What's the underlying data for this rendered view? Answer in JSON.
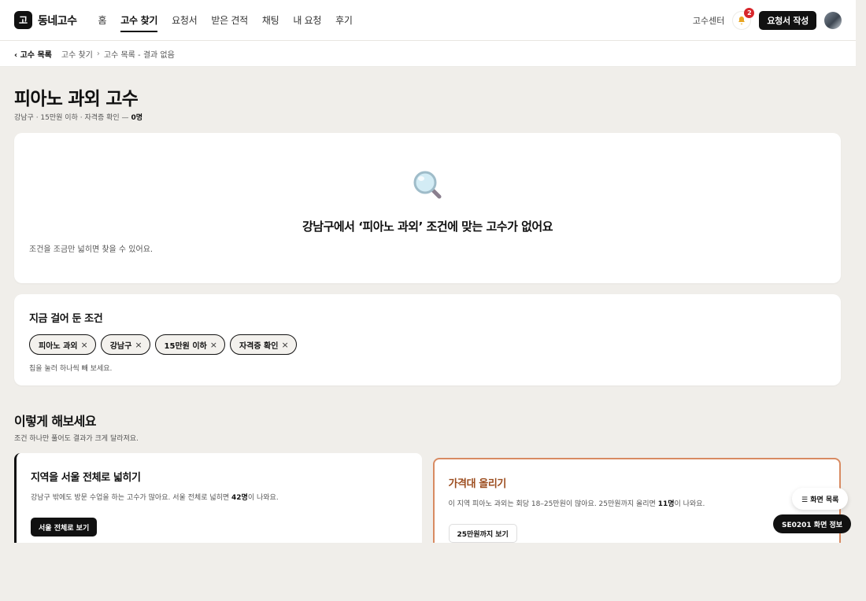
{
  "header": {
    "logo_mark": "고",
    "logo_text": "동네고수",
    "nav": [
      "홈",
      "고수 찾기",
      "요청서",
      "받은 견적",
      "채팅",
      "내 요청",
      "후기"
    ],
    "help_link": "고수센터",
    "notification_count": "2",
    "write_button": "요청서 작성"
  },
  "breadcrumb": {
    "back": "‹ 고수 목록",
    "items": [
      "고수 찾기",
      "고수 목록 - 결과 없음"
    ]
  },
  "page": {
    "title": "피아노 과외 고수",
    "subtitle_prefix": "강남구 · 15만원 이하 · 자격증 확인 —",
    "count": "0명"
  },
  "empty_state": {
    "title": "강남구에서 ‘피아노 과외’ 조건에 맞는 고수가 없어요",
    "description": "조건을 조금만 넓히면 찾을 수 있어요."
  },
  "filters": {
    "heading": "지금 걸어 둔 조건",
    "chips": [
      "피아노 과외",
      "강남구",
      "15만원 이하",
      "자격증 확인"
    ],
    "hint": "칩을 눌러 하나씩 빼 보세요."
  },
  "suggestions": {
    "title": "이렇게 해보세요",
    "subtitle": "조건 하나만 풀어도 결과가 크게 달라져요.",
    "cards": [
      {
        "title": "지역을 서울 전체로 넓히기",
        "desc_pre": "강남구 밖에도 방문 수업을 하는 고수가 많아요. 서울 전체로 넓히면 ",
        "desc_bold": "42명",
        "desc_post": "이 나와요.",
        "button": "서울 전체로 보기"
      },
      {
        "title": "가격대 올리기",
        "desc_pre": "이 지역 피아노 과외는 회당 18–25만원이 많아요. 25만원까지 올리면 ",
        "desc_bold": "11명",
        "desc_post": "이 나와요.",
        "button": "25만원까지 보기"
      }
    ]
  },
  "floating": {
    "list_button": "☰ 화면 목록",
    "info_button": "SE0201 화면 정보"
  },
  "colors": {
    "accent": "#111111",
    "price_card_border": "#d88b62",
    "price_card_title": "#9c4d1f",
    "badge": "#d7262b"
  }
}
